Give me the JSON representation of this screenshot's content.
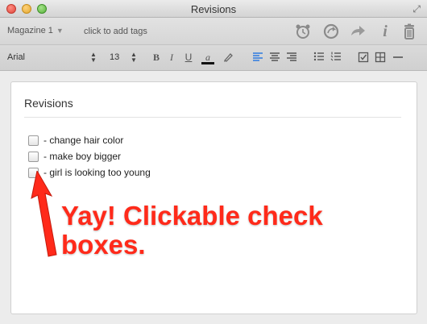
{
  "window": {
    "title": "Revisions"
  },
  "toolbar": {
    "notebook": "Magazine 1",
    "tags_placeholder": "click to add tags",
    "icons": [
      "alarm-icon",
      "share-icon",
      "forward-icon",
      "info-icon",
      "trash-icon"
    ]
  },
  "format_bar": {
    "font": "Arial",
    "size": "13",
    "bold": "B",
    "italic": "I",
    "underline": "U",
    "text_color": "a"
  },
  "note": {
    "title": "Revisions",
    "items": [
      {
        "label": "- change hair color",
        "checked": false
      },
      {
        "label": "- make boy bigger",
        "checked": false
      },
      {
        "label": "- girl is looking too young",
        "checked": false
      }
    ]
  },
  "annotation": {
    "text": "Yay! Clickable check\nboxes.",
    "color": "#ff2a1a"
  }
}
